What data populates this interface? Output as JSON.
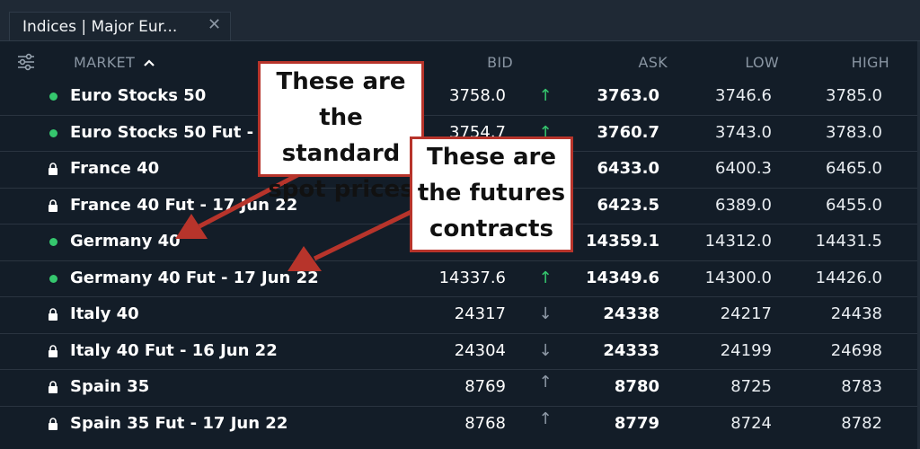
{
  "tab": {
    "title": "Indices | Major Eur...",
    "close_glyph": "✕"
  },
  "header": {
    "market": "MARKET",
    "sort_glyph": "⌃",
    "bid": "BID",
    "ask": "ASK",
    "low": "LOW",
    "high": "HIGH"
  },
  "rows": [
    {
      "market": "Euro Stocks 50",
      "status": "dot",
      "bid": "3758.0",
      "dir": "up",
      "ask": "3763.0",
      "low": "3746.6",
      "high": "3785.0"
    },
    {
      "market": "Euro Stocks 50 Fut - 17 Jun 22",
      "status": "dot",
      "bid": "3754.7",
      "dir": "up",
      "ask": "3760.7",
      "low": "3743.0",
      "high": "3783.0"
    },
    {
      "market": "France 40",
      "status": "lock",
      "bid": "",
      "dir": "",
      "ask": "6433.0",
      "low": "6400.3",
      "high": "6465.0"
    },
    {
      "market": "France 40 Fut - 17 Jun 22",
      "status": "lock",
      "bid": "",
      "dir": "",
      "ask": "6423.5",
      "low": "6389.0",
      "high": "6455.0"
    },
    {
      "market": "Germany 40",
      "status": "dot",
      "bid": "",
      "dir": "",
      "ask": "14359.1",
      "low": "14312.0",
      "high": "14431.5"
    },
    {
      "market": "Germany 40 Fut - 17 Jun 22",
      "status": "dot",
      "bid": "14337.6",
      "dir": "up",
      "ask": "14349.6",
      "low": "14300.0",
      "high": "14426.0"
    },
    {
      "market": "Italy 40",
      "status": "lock",
      "bid": "24317",
      "dir": "down",
      "ask": "24338",
      "low": "24217",
      "high": "24438"
    },
    {
      "market": "Italy 40 Fut - 16 Jun 22",
      "status": "lock",
      "bid": "24304",
      "dir": "down",
      "ask": "24333",
      "low": "24199",
      "high": "24698"
    },
    {
      "market": "Spain 35",
      "status": "lock",
      "bid": "8769",
      "dir": "flat",
      "ask": "8780",
      "low": "8725",
      "high": "8783"
    },
    {
      "market": "Spain 35 Fut - 17 Jun 22",
      "status": "lock",
      "bid": "8768",
      "dir": "flat",
      "ask": "8779",
      "low": "8724",
      "high": "8782"
    }
  ],
  "arrows": {
    "up": "↑",
    "down": "↓",
    "flat": "↑"
  },
  "callouts": {
    "spot": [
      "These are",
      "the standard",
      "spot prices"
    ],
    "futures": [
      "These are",
      "the futures",
      "contracts"
    ]
  },
  "colors": {
    "background": "#131d28",
    "up": "#35c76e",
    "down": "#8e99a6",
    "callout_border": "#b7342b",
    "callout_arrow": "#b7342b"
  }
}
